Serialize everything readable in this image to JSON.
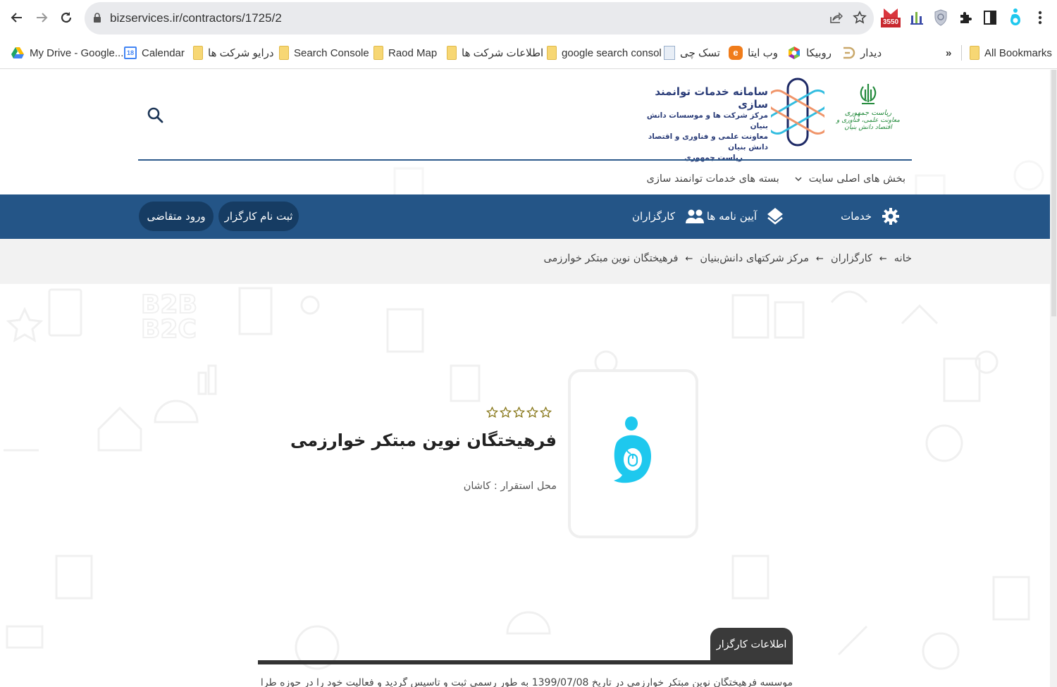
{
  "browser": {
    "url": "bizservices.ir/contractors/1725/2",
    "extension_badge": "3550",
    "bookmarks": [
      {
        "label": "My Drive - Google...",
        "icon": "google-drive-icon"
      },
      {
        "label": "Calendar",
        "icon": "calendar-icon",
        "icon_text": "18"
      },
      {
        "label": "درایو شرکت ها",
        "icon": "folder-icon"
      },
      {
        "label": "Search Console",
        "icon": "folder-icon"
      },
      {
        "label": "Raod Map",
        "icon": "folder-icon"
      },
      {
        "label": "اطلاعات شرکت ها",
        "icon": "folder-icon"
      },
      {
        "label": "google search consol",
        "icon": "folder-icon"
      },
      {
        "label": "تسک چی",
        "icon": "document-icon"
      },
      {
        "label": "وب ایتا",
        "icon": "eitaa-icon"
      },
      {
        "label": "روبیکا",
        "icon": "rubika-icon"
      },
      {
        "label": "دیدار",
        "icon": "didar-icon"
      }
    ],
    "overflow_label": "»",
    "all_bookmarks_label": "All Bookmarks"
  },
  "header": {
    "logo_title": "سامانه خدمات توانمند سازی",
    "logo_lines": [
      "مرکز شرکت ها و موسسات دانش بنیان",
      "معاونت علمی و فناوری و اقتصاد دانش بنیان",
      "ریاست جمهوری"
    ],
    "emblem_line1": "ریاست جمهوری",
    "emblem_line2": "معاونت علمی، فناوری و اقتصاد دانش بنیان",
    "colors": {
      "primary": "#245587",
      "dark_pill": "#163c63",
      "logo_text": "#2a3c78",
      "emblem_green": "#238a3c"
    }
  },
  "subnav": {
    "items": [
      {
        "label": "بخش های اصلی سایت",
        "has_dropdown": true
      },
      {
        "label": "بسته های خدمات توانمند سازی",
        "has_dropdown": false
      }
    ]
  },
  "mainnav": {
    "items": [
      {
        "label": "خدمات",
        "icon": "gear-icon"
      },
      {
        "label": "آیین نامه ها",
        "icon": "layers-icon"
      },
      {
        "label": "کارگزاران",
        "icon": "users-icon"
      }
    ],
    "register_button": "ثبت نام کارگزار",
    "login_button": "ورود متقاضی"
  },
  "breadcrumb": {
    "items": [
      "خانه",
      "کارگزاران",
      "مرکز شرکتهای دانش‌بنیان",
      "فرهیختگان نوین مبتکر خوارزمی"
    ],
    "separator": "←"
  },
  "profile": {
    "name": "فرهیختگان نوین مبتکر خوارزمی",
    "rating": 0,
    "rating_max": 5,
    "location": "محل استقرار : کاشان",
    "logo_color": "#1ec8ee"
  },
  "info": {
    "tab_label": "اطلاعات کارگزار",
    "description": "موسسه فرهیختگان نوین مبتکر خوارزمی در تاریخ 1399/07/08 به طور رسمی ثبت و تاسیس گردید و فعالیت خود را در حوزه طراحی"
  }
}
